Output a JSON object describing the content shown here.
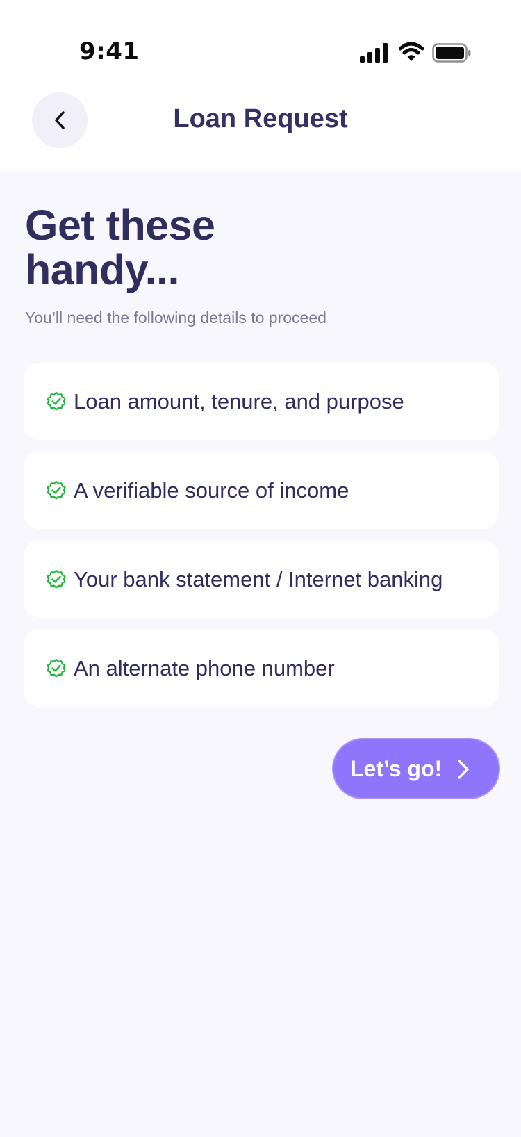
{
  "status_bar": {
    "time": "9:41",
    "icons": [
      "signal-icon",
      "wifi-icon",
      "battery-icon"
    ]
  },
  "header": {
    "back_icon": "chevron-left-icon",
    "title": "Loan Request"
  },
  "hero": {
    "title_line1": "Get these",
    "title_line2": "handy...",
    "subtitle": "You’ll need the following details to proceed"
  },
  "checklist": {
    "icon": "check-badge-icon",
    "items": [
      {
        "label": "Loan amount, tenure, and purpose"
      },
      {
        "label": "A verifiable source of income"
      },
      {
        "label": "Your bank statement / Internet banking"
      },
      {
        "label": "An alternate phone number"
      }
    ]
  },
  "cta": {
    "label": "Let’s go!",
    "icon": "chevron-right-icon"
  },
  "colors": {
    "background": "#f8f7fe",
    "heading": "#2f2e5f",
    "accent": "#8e75fb",
    "check_green": "#1fb83a"
  }
}
